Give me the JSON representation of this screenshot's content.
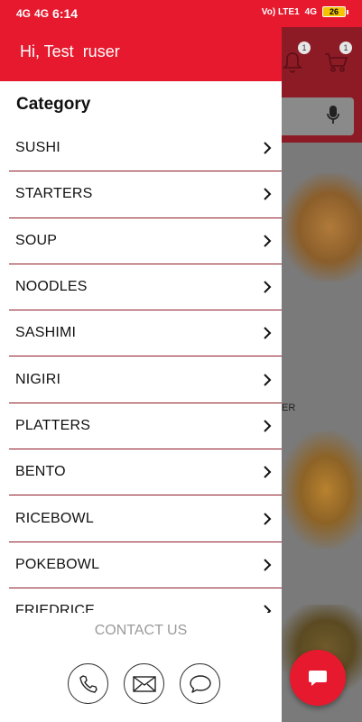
{
  "status_bar": {
    "network": "4G",
    "network2": "4G",
    "time": "6:14",
    "right_text": "Vo) LTE1",
    "network_right": "4G",
    "battery": "26"
  },
  "drawer": {
    "greeting": "Hi, Test  ruser",
    "category_title": "Category",
    "categories": [
      {
        "label": "SUSHI"
      },
      {
        "label": "STARTERS"
      },
      {
        "label": "SOUP"
      },
      {
        "label": "NOODLES"
      },
      {
        "label": "SASHIMI"
      },
      {
        "label": "NIGIRI"
      },
      {
        "label": "PLATTERS"
      },
      {
        "label": "BENTO"
      },
      {
        "label": "RICEBOWL"
      },
      {
        "label": "POKEBOWL"
      },
      {
        "label": "FRIEDRICE"
      }
    ],
    "contact_title": "CONTACT US",
    "contact_icons": [
      "phone-icon",
      "mail-icon",
      "chat-icon"
    ]
  },
  "background": {
    "notification_count": "1",
    "cart_count": "1",
    "partial_label": "ER"
  },
  "colors": {
    "brand_red": "#e6192e",
    "divider": "#8d1b26"
  }
}
